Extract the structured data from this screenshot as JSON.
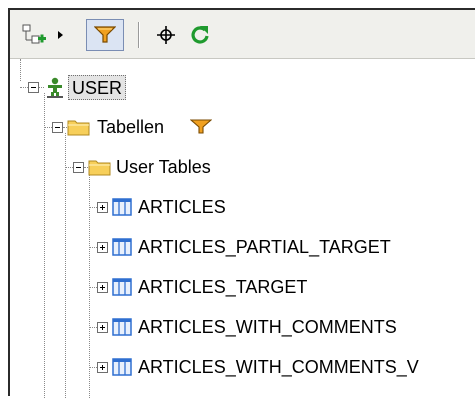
{
  "toolbar": {
    "buttons": [
      {
        "icon": "add-node-icon",
        "dropdown": true
      },
      {
        "icon": "filter-icon",
        "active": true
      },
      {
        "icon": "crosshair-icon"
      },
      {
        "icon": "refresh-icon"
      }
    ]
  },
  "tree": {
    "root": {
      "label": "USER",
      "icon": "user-schema-icon",
      "expanded": true
    },
    "folder": {
      "label": "Tabellen",
      "icon": "folder-icon",
      "filter_icon": "filter-icon",
      "expanded": true
    },
    "subfolder": {
      "label": "User Tables",
      "icon": "folder-icon",
      "expanded": true
    },
    "tables": [
      {
        "label": "ARTICLES",
        "icon": "table-icon",
        "expanded": false
      },
      {
        "label": "ARTICLES_PARTIAL_TARGET",
        "icon": "table-icon",
        "expanded": false
      },
      {
        "label": "ARTICLES_TARGET",
        "icon": "table-icon",
        "expanded": false
      },
      {
        "label": "ARTICLES_WITH_COMMENTS",
        "icon": "table-icon",
        "expanded": false
      },
      {
        "label": "ARTICLES_WITH_COMMENTS_V",
        "icon": "table-icon",
        "expanded": false
      }
    ]
  },
  "colors": {
    "filter": "#f0a020",
    "folder": "#f7cf5a",
    "table": "#2f6fd0",
    "refresh": "#1f9a2e",
    "user": "#3a8a2a"
  }
}
